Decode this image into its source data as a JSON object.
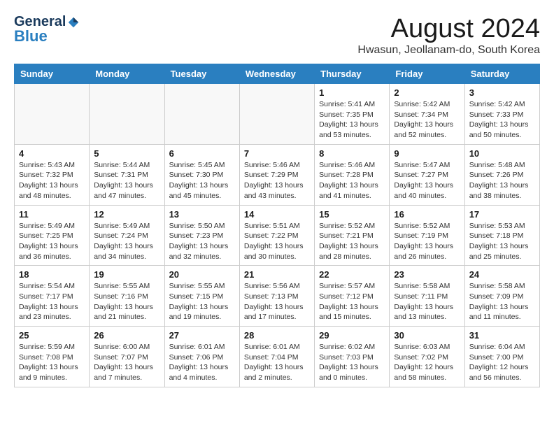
{
  "logo": {
    "general": "General",
    "blue": "Blue"
  },
  "title": "August 2024",
  "subtitle": "Hwasun, Jeollanam-do, South Korea",
  "headers": [
    "Sunday",
    "Monday",
    "Tuesday",
    "Wednesday",
    "Thursday",
    "Friday",
    "Saturday"
  ],
  "weeks": [
    [
      {
        "day": "",
        "info": ""
      },
      {
        "day": "",
        "info": ""
      },
      {
        "day": "",
        "info": ""
      },
      {
        "day": "",
        "info": ""
      },
      {
        "day": "1",
        "info": "Sunrise: 5:41 AM\nSunset: 7:35 PM\nDaylight: 13 hours\nand 53 minutes."
      },
      {
        "day": "2",
        "info": "Sunrise: 5:42 AM\nSunset: 7:34 PM\nDaylight: 13 hours\nand 52 minutes."
      },
      {
        "day": "3",
        "info": "Sunrise: 5:42 AM\nSunset: 7:33 PM\nDaylight: 13 hours\nand 50 minutes."
      }
    ],
    [
      {
        "day": "4",
        "info": "Sunrise: 5:43 AM\nSunset: 7:32 PM\nDaylight: 13 hours\nand 48 minutes."
      },
      {
        "day": "5",
        "info": "Sunrise: 5:44 AM\nSunset: 7:31 PM\nDaylight: 13 hours\nand 47 minutes."
      },
      {
        "day": "6",
        "info": "Sunrise: 5:45 AM\nSunset: 7:30 PM\nDaylight: 13 hours\nand 45 minutes."
      },
      {
        "day": "7",
        "info": "Sunrise: 5:46 AM\nSunset: 7:29 PM\nDaylight: 13 hours\nand 43 minutes."
      },
      {
        "day": "8",
        "info": "Sunrise: 5:46 AM\nSunset: 7:28 PM\nDaylight: 13 hours\nand 41 minutes."
      },
      {
        "day": "9",
        "info": "Sunrise: 5:47 AM\nSunset: 7:27 PM\nDaylight: 13 hours\nand 40 minutes."
      },
      {
        "day": "10",
        "info": "Sunrise: 5:48 AM\nSunset: 7:26 PM\nDaylight: 13 hours\nand 38 minutes."
      }
    ],
    [
      {
        "day": "11",
        "info": "Sunrise: 5:49 AM\nSunset: 7:25 PM\nDaylight: 13 hours\nand 36 minutes."
      },
      {
        "day": "12",
        "info": "Sunrise: 5:49 AM\nSunset: 7:24 PM\nDaylight: 13 hours\nand 34 minutes."
      },
      {
        "day": "13",
        "info": "Sunrise: 5:50 AM\nSunset: 7:23 PM\nDaylight: 13 hours\nand 32 minutes."
      },
      {
        "day": "14",
        "info": "Sunrise: 5:51 AM\nSunset: 7:22 PM\nDaylight: 13 hours\nand 30 minutes."
      },
      {
        "day": "15",
        "info": "Sunrise: 5:52 AM\nSunset: 7:21 PM\nDaylight: 13 hours\nand 28 minutes."
      },
      {
        "day": "16",
        "info": "Sunrise: 5:52 AM\nSunset: 7:19 PM\nDaylight: 13 hours\nand 26 minutes."
      },
      {
        "day": "17",
        "info": "Sunrise: 5:53 AM\nSunset: 7:18 PM\nDaylight: 13 hours\nand 25 minutes."
      }
    ],
    [
      {
        "day": "18",
        "info": "Sunrise: 5:54 AM\nSunset: 7:17 PM\nDaylight: 13 hours\nand 23 minutes."
      },
      {
        "day": "19",
        "info": "Sunrise: 5:55 AM\nSunset: 7:16 PM\nDaylight: 13 hours\nand 21 minutes."
      },
      {
        "day": "20",
        "info": "Sunrise: 5:55 AM\nSunset: 7:15 PM\nDaylight: 13 hours\nand 19 minutes."
      },
      {
        "day": "21",
        "info": "Sunrise: 5:56 AM\nSunset: 7:13 PM\nDaylight: 13 hours\nand 17 minutes."
      },
      {
        "day": "22",
        "info": "Sunrise: 5:57 AM\nSunset: 7:12 PM\nDaylight: 13 hours\nand 15 minutes."
      },
      {
        "day": "23",
        "info": "Sunrise: 5:58 AM\nSunset: 7:11 PM\nDaylight: 13 hours\nand 13 minutes."
      },
      {
        "day": "24",
        "info": "Sunrise: 5:58 AM\nSunset: 7:09 PM\nDaylight: 13 hours\nand 11 minutes."
      }
    ],
    [
      {
        "day": "25",
        "info": "Sunrise: 5:59 AM\nSunset: 7:08 PM\nDaylight: 13 hours\nand 9 minutes."
      },
      {
        "day": "26",
        "info": "Sunrise: 6:00 AM\nSunset: 7:07 PM\nDaylight: 13 hours\nand 7 minutes."
      },
      {
        "day": "27",
        "info": "Sunrise: 6:01 AM\nSunset: 7:06 PM\nDaylight: 13 hours\nand 4 minutes."
      },
      {
        "day": "28",
        "info": "Sunrise: 6:01 AM\nSunset: 7:04 PM\nDaylight: 13 hours\nand 2 minutes."
      },
      {
        "day": "29",
        "info": "Sunrise: 6:02 AM\nSunset: 7:03 PM\nDaylight: 13 hours\nand 0 minutes."
      },
      {
        "day": "30",
        "info": "Sunrise: 6:03 AM\nSunset: 7:02 PM\nDaylight: 12 hours\nand 58 minutes."
      },
      {
        "day": "31",
        "info": "Sunrise: 6:04 AM\nSunset: 7:00 PM\nDaylight: 12 hours\nand 56 minutes."
      }
    ]
  ]
}
